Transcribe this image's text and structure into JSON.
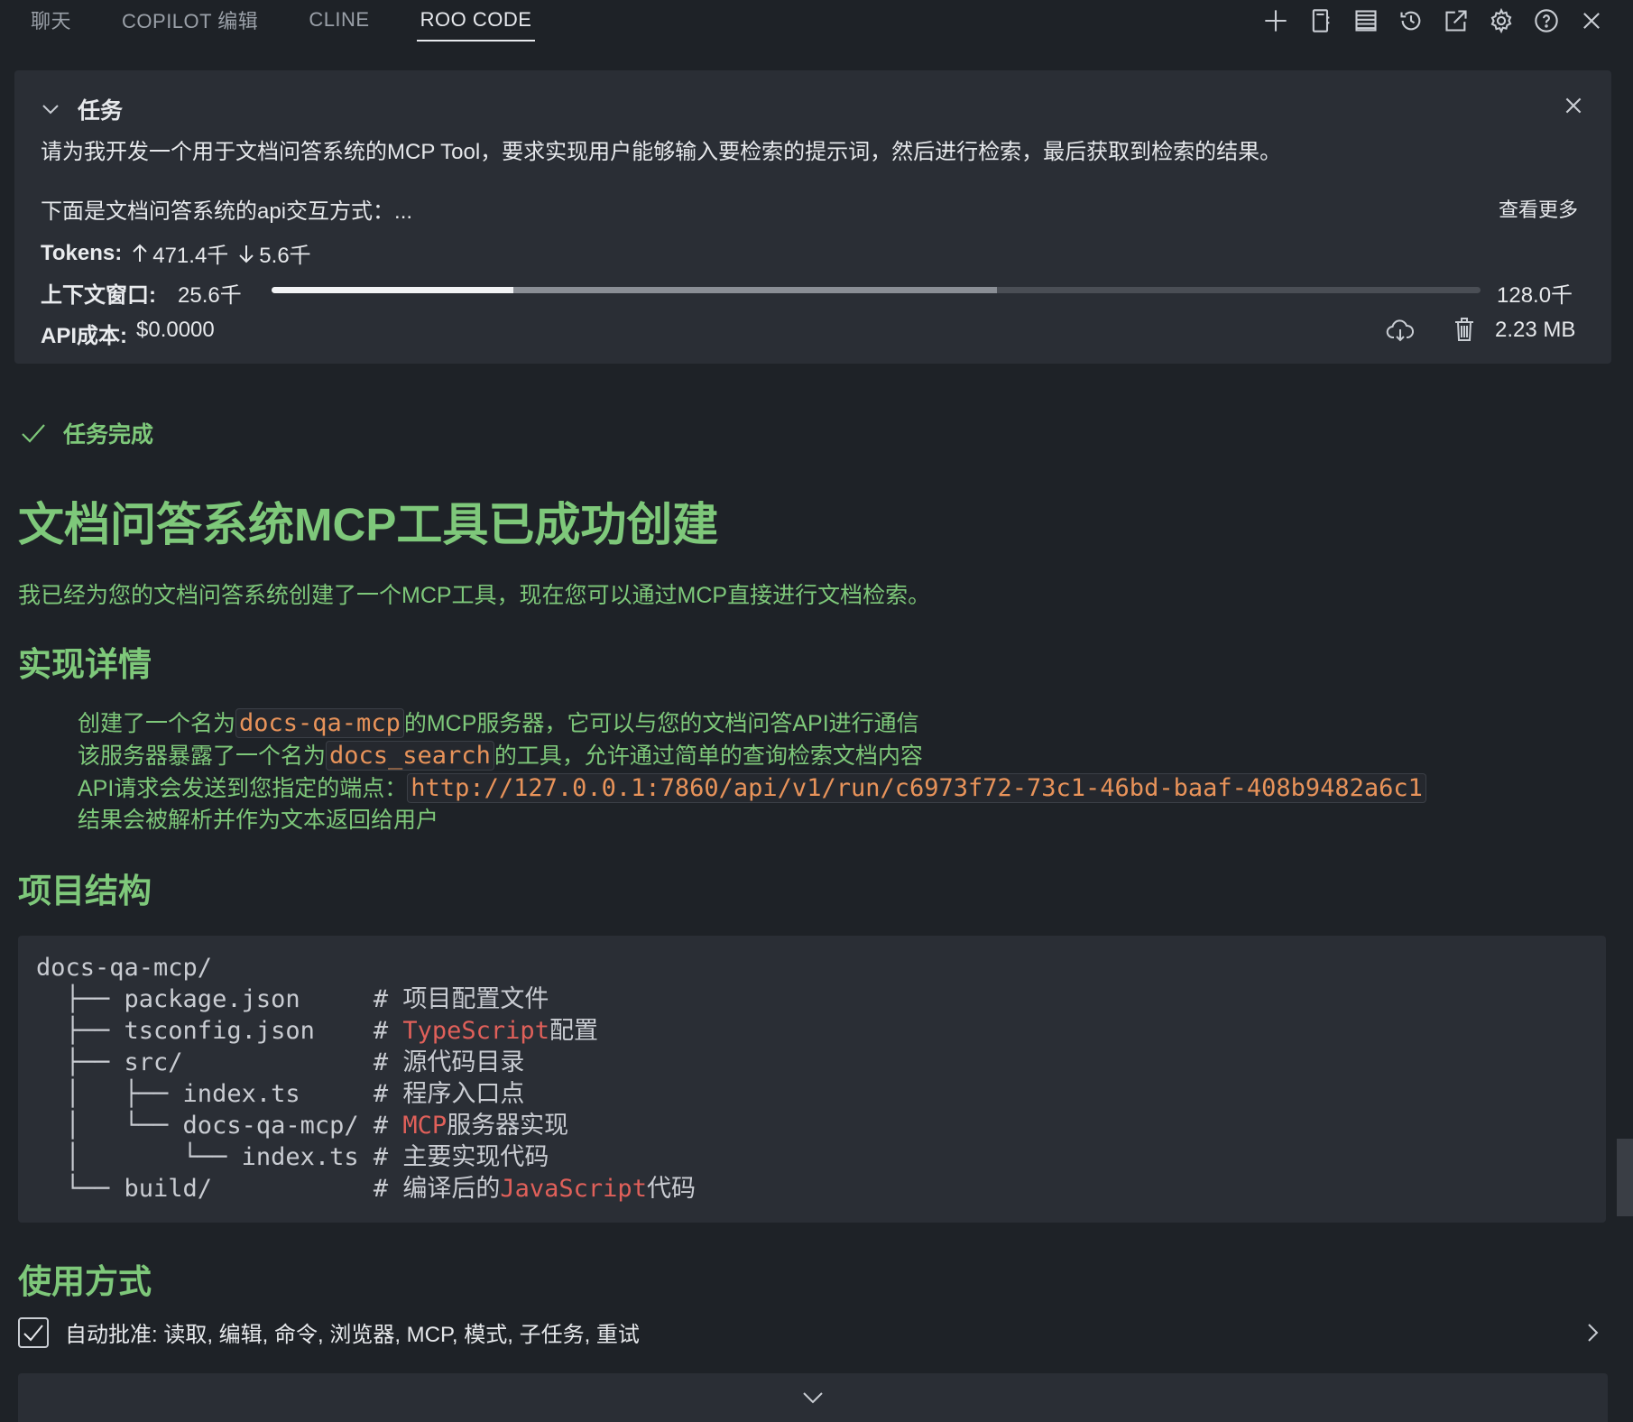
{
  "tabs": [
    {
      "label": "聊天"
    },
    {
      "label": "COPILOT 编辑"
    },
    {
      "label": "CLINE"
    },
    {
      "label": "ROO CODE",
      "active": true
    }
  ],
  "toolbar_icons": [
    "plus-icon",
    "notebook-icon",
    "server-icon",
    "history-icon",
    "open-external-icon",
    "gear-icon",
    "help-icon",
    "close-icon"
  ],
  "task": {
    "header": "任务",
    "prompt": "请为我开发一个用于文档问答系统的MCP Tool，要求实现用户能够输入要检索的提示词，然后进行检索，最后获取到检索的结果。",
    "prompt_more": "下面是文档问答系统的api交互方式：...",
    "see_more": "查看更多",
    "tokens_label": "Tokens:",
    "tokens_up": "471.4千",
    "tokens_down": "5.6千",
    "context_label": "上下文窗口:",
    "context_used": "25.6千",
    "context_max": "128.0千",
    "context_used_fraction": 0.2,
    "context_reserved_fraction": 0.4,
    "cost_label": "API成本:",
    "cost_value": "$0.0000",
    "storage_size": "2.23 MB"
  },
  "completion": {
    "label": "任务完成",
    "title": "文档问答系统MCP工具已成功创建",
    "intro": "我已经为您的文档问答系统创建了一个MCP工具，现在您可以通过MCP直接进行文档检索。",
    "section_impl": "实现详情",
    "impl": {
      "l1_pre": "创建了一个名为",
      "l1_code": "docs-qa-mcp",
      "l1_post": "的MCP服务器，它可以与您的文档问答API进行通信",
      "l2_pre": "该服务器暴露了一个名为",
      "l2_code": "docs_search",
      "l2_post": "的工具，允许通过简单的查询检索文档内容",
      "l3_pre": "API请求会发送到您指定的端点：",
      "l3_code": "http://127.0.0.1:7860/api/v1/run/c6973f72-73c1-46bd-baaf-408b9482a6c1",
      "l4": "结果会被解析并作为文本返回给用户"
    },
    "section_structure": "项目结构",
    "tree": {
      "root": "docs-qa-mcp/",
      "r1": "  ├── package.json     # ",
      "r1c": "项目配置文件",
      "r2": "  ├── tsconfig.json    # ",
      "r2h": "TypeScript",
      "r2c": "配置",
      "r3": "  ├── src/             # ",
      "r3c": "源代码目录",
      "r4": "  │   ├── index.ts     # ",
      "r4c": "程序入口点",
      "r5": "  │   └── docs-qa-mcp/ # ",
      "r5h": "MCP",
      "r5c": "服务器实现",
      "r6": "  │       └── index.ts # ",
      "r6c": "主要实现代码",
      "r7": "  └── build/           # ",
      "r7c": "编译后的",
      "r7h": "JavaScript",
      "r7c2": "代码"
    },
    "section_usage": "使用方式"
  },
  "auto_approve": {
    "checked": true,
    "label": "自动批准: 读取, 编辑, 命令, 浏览器, MCP, 模式, 子任务, 重试"
  }
}
